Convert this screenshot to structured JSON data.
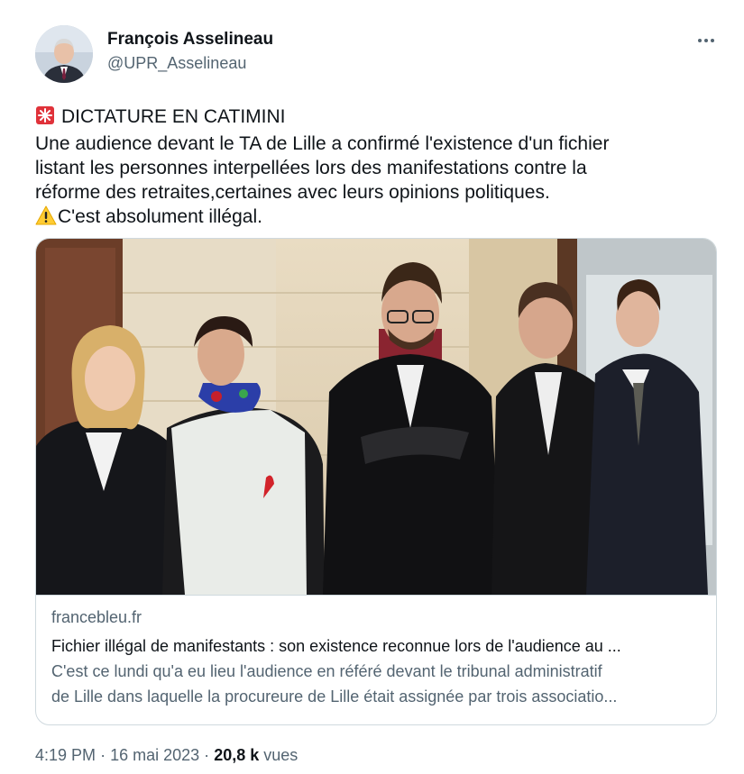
{
  "author": {
    "name": "François Asselineau",
    "handle": "@UPR_Asselineau"
  },
  "tweet": {
    "line1": "DICTATURE EN CATIMINI",
    "line2": "Une audience devant le TA de Lille a confirmé l'existence d'un fichier",
    "line3": "listant les personnes interpellées lors des manifestations contre la",
    "line4": "réforme des retraites,certaines avec leurs opinions politiques.",
    "line5": "C'est absolument illégal.",
    "icon1": "rotating-light-icon",
    "icon2": "warning-icon"
  },
  "card": {
    "domain": "francebleu.fr",
    "title": "Fichier illégal de manifestants : son existence reconnue lors de l'audience au ...",
    "desc1": "C'est ce lundi qu'a eu lieu l'audience en référé devant le tribunal administratif",
    "desc2": "de Lille dans laquelle la procureure de Lille était assignée par trois associatio..."
  },
  "meta": {
    "time": "4:19 PM",
    "sep": "·",
    "date": "16 mai 2023",
    "views_count": "20,8 k",
    "views_label": "vues"
  },
  "colors": {
    "text": "#0f1419",
    "secondary": "#536471",
    "border": "#cfd9de"
  }
}
